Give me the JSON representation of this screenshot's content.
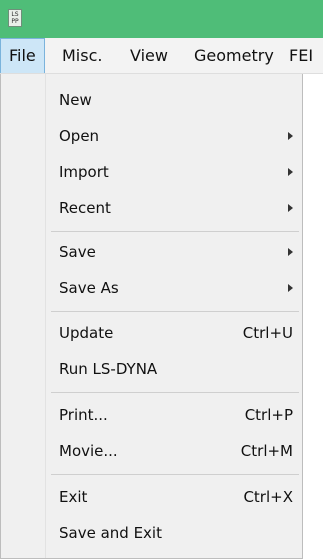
{
  "app": {
    "icon_text_line1": "LS",
    "icon_text_line2": "PP",
    "title_bar_color": "#4fbd78"
  },
  "menubar": {
    "items": [
      {
        "label": "File",
        "active": true
      },
      {
        "label": "Misc."
      },
      {
        "label": "View"
      },
      {
        "label": "Geometry"
      },
      {
        "label": "FEI"
      }
    ]
  },
  "file_menu": {
    "items": [
      {
        "label": "New",
        "shortcut": "",
        "submenu": false
      },
      {
        "label": "Open",
        "shortcut": "",
        "submenu": true
      },
      {
        "label": "Import",
        "shortcut": "",
        "submenu": true
      },
      {
        "label": "Recent",
        "shortcut": "",
        "submenu": true
      },
      {
        "label": "Save",
        "shortcut": "",
        "submenu": true
      },
      {
        "label": "Save As",
        "shortcut": "",
        "submenu": true
      },
      {
        "label": "Update",
        "shortcut": "Ctrl+U",
        "submenu": false
      },
      {
        "label": "Run LS-DYNA",
        "shortcut": "",
        "submenu": false
      },
      {
        "label": "Print...",
        "shortcut": "Ctrl+P",
        "submenu": false
      },
      {
        "label": "Movie...",
        "shortcut": "Ctrl+M",
        "submenu": false
      },
      {
        "label": "Exit",
        "shortcut": "Ctrl+X",
        "submenu": false
      },
      {
        "label": "Save and Exit",
        "shortcut": "",
        "submenu": false
      }
    ]
  }
}
